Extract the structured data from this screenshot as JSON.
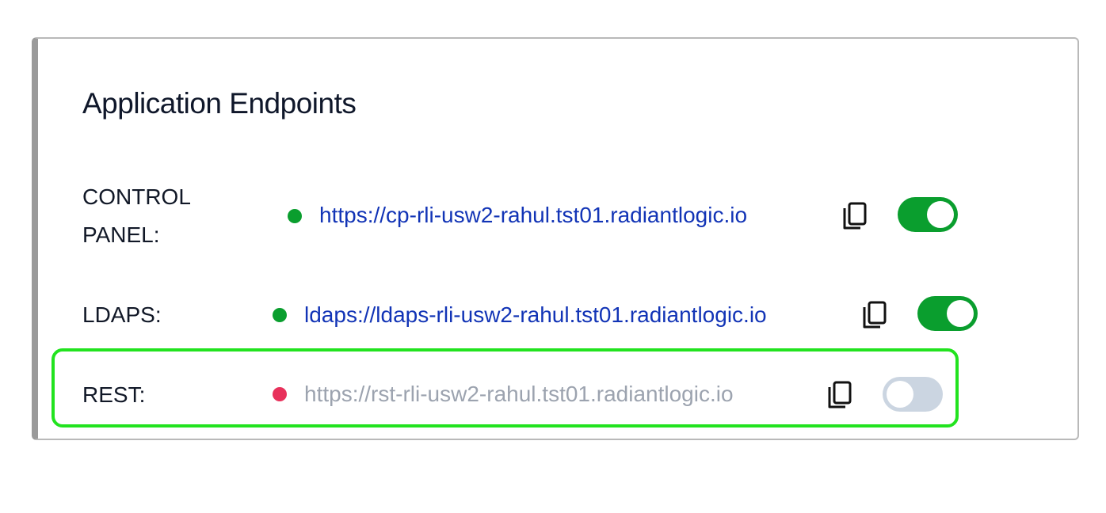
{
  "panel": {
    "title": "Application Endpoints"
  },
  "endpoints": [
    {
      "label_line1": "CONTROL",
      "label_line2": "PANEL:",
      "url": "https://cp-rli-usw2-rahul.tst01.radiantlogic.io",
      "status": "online",
      "status_color": "#0a9e2e",
      "enabled": true
    },
    {
      "label": "LDAPS:",
      "url": "ldaps://ldaps-rli-usw2-rahul.tst01.radiantlogic.io",
      "status": "online",
      "status_color": "#0a9e2e",
      "enabled": true
    },
    {
      "label": "REST:",
      "url": "https://rst-rli-usw2-rahul.tst01.radiantlogic.io",
      "status": "offline",
      "status_color": "#e8315b",
      "enabled": false
    }
  ],
  "icons": {
    "copy": "copy-icon",
    "status": "status-dot-icon"
  },
  "colors": {
    "link": "#1234b6",
    "disabled_link": "#9ca3af",
    "toggle_on": "#0a9e2e",
    "toggle_off": "#cbd5e1",
    "highlight": "#22e31f"
  }
}
